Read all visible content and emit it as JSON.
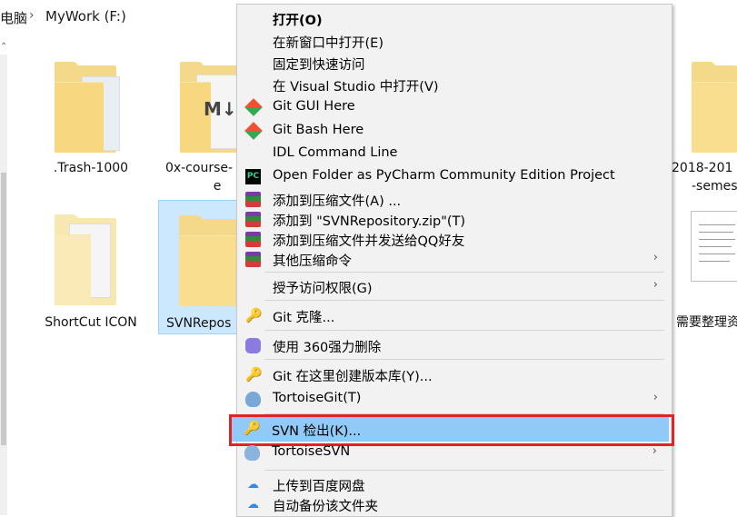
{
  "breadcrumb": {
    "segment_prev": "电脑",
    "segment_current": "MyWork (F:)"
  },
  "files": [
    {
      "name": ".Trash-1000"
    },
    {
      "name": "0x-course-"
    },
    {
      "name": "e"
    },
    {
      "name": "2018-201"
    },
    {
      "name": "-semes"
    },
    {
      "name": "ShortCut ICON"
    },
    {
      "name": "SVNRepos"
    },
    {
      "name": "需要整理资"
    }
  ],
  "context_menu": {
    "items": [
      {
        "label": "打开(O)",
        "icon": "none",
        "bold": true
      },
      {
        "label": "在新窗口中打开(E)",
        "icon": "none"
      },
      {
        "label": "固定到快速访问",
        "icon": "none"
      },
      {
        "label": "在 Visual Studio 中打开(V)",
        "icon": "none"
      },
      {
        "label": "Git GUI Here",
        "icon": "git-icon"
      },
      {
        "label": "Git Bash Here",
        "icon": "git-icon"
      },
      {
        "label": "IDL Command Line",
        "icon": "none"
      },
      {
        "label": "Open Folder as PyCharm Community Edition Project",
        "icon": "pycharm-icon",
        "icon_text": "PC"
      },
      {
        "label": "添加到压缩文件(A) ...",
        "icon": "winrar-icon"
      },
      {
        "label": "添加到 \"SVNRepository.zip\"(T)",
        "icon": "winrar-icon"
      },
      {
        "label": "添加到压缩文件并发送给QQ好友",
        "icon": "winrar-icon"
      },
      {
        "label": "其他压缩命令",
        "icon": "winrar-icon",
        "submenu": true
      },
      {
        "label": "授予访问权限(G)",
        "icon": "none",
        "submenu": true
      },
      {
        "label": "Git 克隆...",
        "icon": "tortoisegit-key-icon"
      },
      {
        "label": "使用 360强力删除",
        "icon": "360-delete-icon"
      },
      {
        "label": "Git 在这里创建版本库(Y)...",
        "icon": "tortoisegit-create-icon"
      },
      {
        "label": "TortoiseGit(T)",
        "icon": "tortoisegit-icon",
        "submenu": true
      },
      {
        "label": "SVN 检出(K)...",
        "icon": "svn-checkout-icon",
        "highlighted": true
      },
      {
        "label": "TortoiseSVN",
        "icon": "tortoisesvn-icon",
        "submenu": true
      },
      {
        "label": "上传到百度网盘",
        "icon": "baidu-netdisk-icon"
      },
      {
        "label": "自动备份该文件夹",
        "icon": "baidu-netdisk-icon"
      }
    ],
    "submenu_glyph": "›"
  },
  "colors": {
    "highlight": "#91c9f7",
    "annotation_box": "#e1222a",
    "folder": "#f9de8f",
    "selection": "#cce8ff"
  }
}
